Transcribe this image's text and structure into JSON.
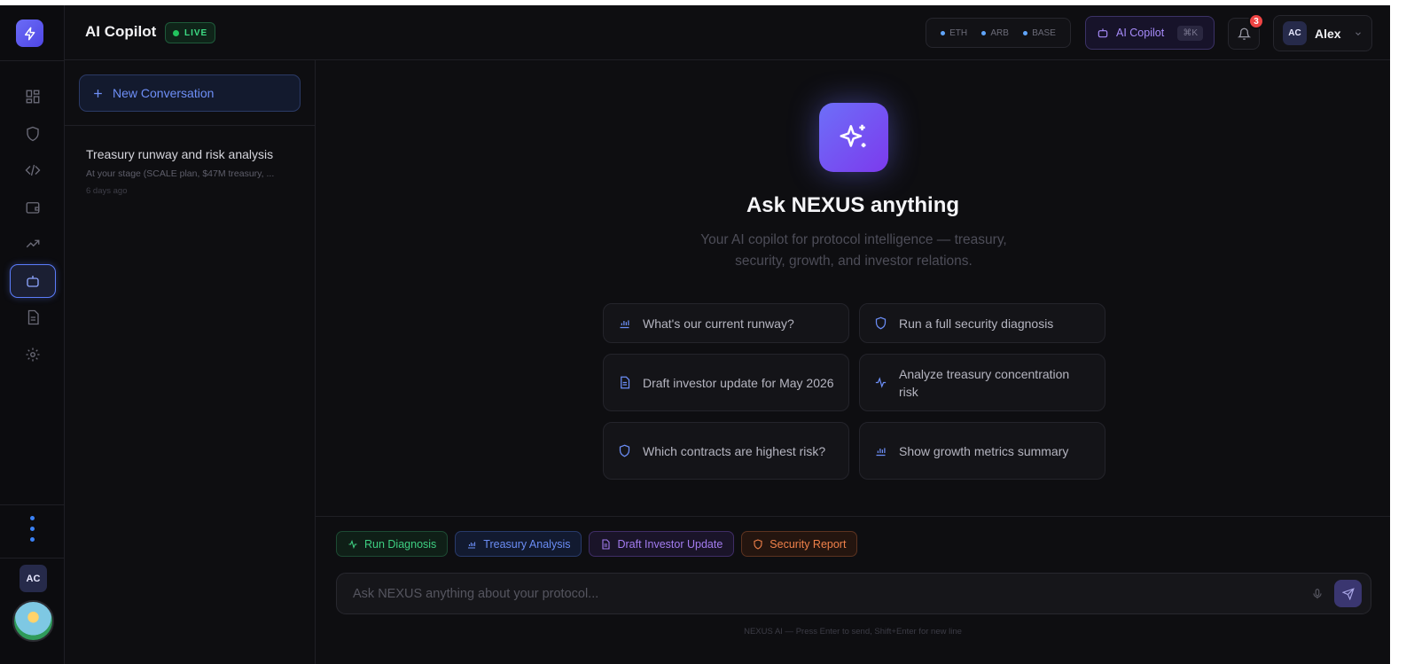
{
  "header": {
    "title": "AI Copilot",
    "live_label": "LIVE",
    "chains": [
      "ETH",
      "ARB",
      "BASE"
    ],
    "copilot_button_label": "AI Copilot",
    "copilot_shortcut": "⌘K",
    "notification_count": "3",
    "user_initials": "AC",
    "user_name": "Alex"
  },
  "rail": {
    "nav_icons": [
      "dashboard-icon",
      "shield-icon",
      "code-icon",
      "wallet-icon",
      "trending-up-icon",
      "bot-icon",
      "document-icon",
      "gear-icon"
    ],
    "active_item": "bot-icon",
    "avatar_initials": "AC"
  },
  "conversations": {
    "new_label": "New Conversation",
    "items": [
      {
        "title": "Treasury runway and risk analysis",
        "preview": "At your stage (SCALE plan, $47M treasury, ...",
        "date": "6 days ago"
      }
    ]
  },
  "main": {
    "hero_title": "Ask NEXUS anything",
    "hero_subtitle": "Your AI copilot for protocol intelligence — treasury, security, growth, and investor relations.",
    "suggestions": [
      {
        "label": "What's our current runway?",
        "icon": "bar-chart-icon"
      },
      {
        "label": "Run a full security diagnosis",
        "icon": "shield-icon"
      },
      {
        "label": "Draft investor update for May 2026",
        "icon": "document-icon"
      },
      {
        "label": "Analyze treasury concentration risk",
        "icon": "activity-icon"
      },
      {
        "label": "Which contracts are highest risk?",
        "icon": "shield-icon"
      },
      {
        "label": "Show growth metrics summary",
        "icon": "bar-chart-icon"
      }
    ],
    "quick_actions": [
      {
        "label": "Run Diagnosis",
        "color": "#3ecf82"
      },
      {
        "label": "Treasury Analysis",
        "color": "#6b8df5"
      },
      {
        "label": "Draft Investor Update",
        "color": "#a37cf0"
      },
      {
        "label": "Security Report",
        "color": "#f0814a"
      }
    ],
    "input_placeholder": "Ask NEXUS anything about your protocol...",
    "footnote": "NEXUS AI — Press Enter to send, Shift+Enter for new line"
  },
  "colors": {
    "accent": "#6d6ff8",
    "live": "#22c55e",
    "badge": "#ef4444"
  }
}
